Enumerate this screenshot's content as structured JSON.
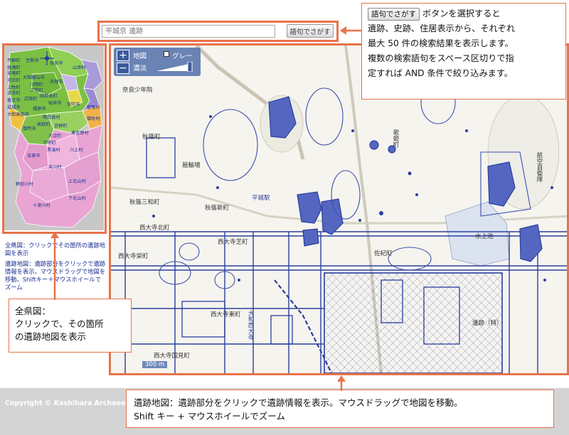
{
  "search": {
    "placeholder": "平城京 遺跡",
    "button_label": "語句でさがす"
  },
  "map_controls": {
    "zoom_in": "+",
    "zoom_out": "−",
    "map_label": "地図",
    "gray_label": "グレー",
    "opacity_label": "濃淡"
  },
  "overview_map": {
    "regions": [
      "平群町",
      "生駒市",
      "奈良市",
      "山添村",
      "斑鳩町",
      "安堵町",
      "大和郡山市",
      "天理市",
      "川西町",
      "三宅町",
      "田原本町",
      "桜井市",
      "宇陀市",
      "曽爾村",
      "御杖村",
      "河合町",
      "上牧町",
      "王寺町",
      "広陵町",
      "香芝市",
      "葛城市",
      "大和高田市",
      "橿原市",
      "明日香村",
      "高取町",
      "御所市",
      "吉野町",
      "大淀町",
      "下市町",
      "黒滝村",
      "東吉野村",
      "川上村",
      "天川村",
      "五條市",
      "野迫川村",
      "上北山村",
      "下北山村",
      "十津川村"
    ]
  },
  "help": {
    "overview": "全県図：クリックでその箇所の遺跡地図を表示",
    "main": "遺跡地図：遺跡部分をクリックで遺跡情報を表示。マウスドラッグで地図を移動。Shiftキー＋マウスホイールでズーム"
  },
  "map_labels": {
    "narasyonen": "奈良少年院",
    "akishino": "秋篠町",
    "keirinjo": "競輪場",
    "akishino_sanwa": "秋篠三和町",
    "akishino_shinmachi": "秋篠新町",
    "heijo_station": "平城駅",
    "saidaiji_kita": "西大寺北町",
    "saidaiji_shiba": "西大寺芝町",
    "saidaiji_higashi": "西大寺東町",
    "saidaiji_sakae": "西大寺栄町",
    "saidaiji_kofu": "西大寺国見町",
    "saki": "佐紀町",
    "yamato_saidaiji": "大和西大寺",
    "scale": "300 m",
    "uta": "歌姫町",
    "mizukami": "水上池",
    "ishiki": "遺跡（特）",
    "koushoku": "航空自衛隊"
  },
  "callouts": {
    "search_key": "語句でさがす",
    "search_line1": "ボタンを選択すると",
    "search_line2": "遺跡、史跡、住居表示から、それぞれ",
    "search_line3": "最大 50 件の検索結果を表示します。",
    "search_line4": "複数の検索語句をスペース区切りで指",
    "search_line5": "定すれば AND 条件で絞り込みます。",
    "overview_line1": "全県図：",
    "overview_line2": "クリックで、その箇所",
    "overview_line3": "の遺跡地図を表示",
    "main_line1": "遺跡地図：遺跡部分をクリックで遺跡情報を表示。マウスドラッグで地図を移動。",
    "main_line2": "Shift キー + マウスホイールでズーム"
  },
  "footer": {
    "copyright": "Copyright © Kashihara Archaeol"
  },
  "colors": {
    "accent_orange": "#e8734a",
    "site_blue": "#2a3fa0",
    "help_text_blue": "#1a2f8f"
  }
}
